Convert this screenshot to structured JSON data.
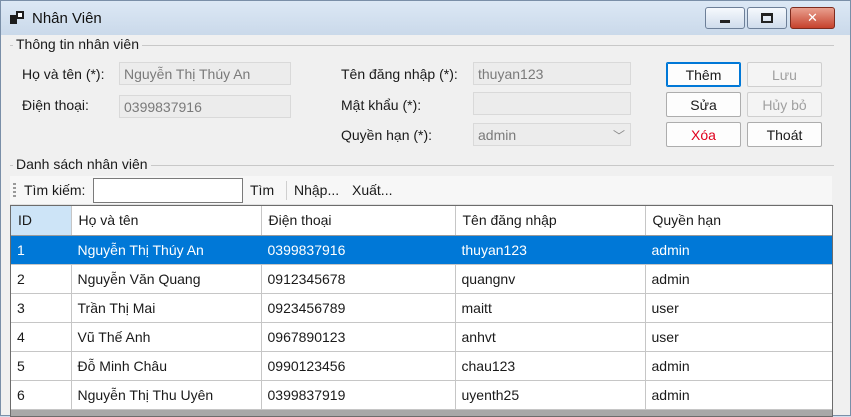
{
  "window": {
    "title": "Nhân Viên"
  },
  "info_group": {
    "title": "Thông tin nhân viên",
    "fullname_label": "Họ và tên (*):",
    "fullname_value": "Nguyễn Thị Thúy An",
    "phone_label": "Điện thoại:",
    "phone_value": "0399837916",
    "username_label": "Tên đăng nhập (*):",
    "username_value": "thuyan123",
    "password_label": "Mật khẩu (*):",
    "password_value": "",
    "role_label": "Quyền hạn (*):",
    "role_value": "admin"
  },
  "buttons": {
    "add": "Thêm",
    "save": "Lưu",
    "edit": "Sửa",
    "cancel": "Hủy bỏ",
    "delete": "Xóa",
    "exit": "Thoát"
  },
  "list_group": {
    "title": "Danh sách nhân viên"
  },
  "toolbar": {
    "search_label": "Tìm kiếm:",
    "search_value": "",
    "find": "Tìm",
    "import": "Nhập...",
    "export": "Xuất..."
  },
  "table": {
    "columns": [
      "ID",
      "Họ và tên",
      "Điện thoại",
      "Tên đăng nhập",
      "Quyền hạn"
    ],
    "rows": [
      [
        "1",
        "Nguyễn Thị Thúy An",
        "0399837916",
        "thuyan123",
        "admin"
      ],
      [
        "2",
        "Nguyễn Văn Quang",
        "0912345678",
        "quangnv",
        "admin"
      ],
      [
        "3",
        "Trần Thị Mai",
        "0923456789",
        "maitt",
        "user"
      ],
      [
        "4",
        "Vũ Thế Anh",
        "0967890123",
        "anhvt",
        "user"
      ],
      [
        "5",
        "Đỗ Minh Châu",
        "0990123456",
        "chau123",
        "admin"
      ],
      [
        "6",
        "Nguyễn Thị Thu Uyên",
        "0399837919",
        "uyenth25",
        "admin"
      ]
    ],
    "selected_row": 0
  },
  "colors": {
    "selection": "#0078d7",
    "delete_text": "#e0001c"
  }
}
